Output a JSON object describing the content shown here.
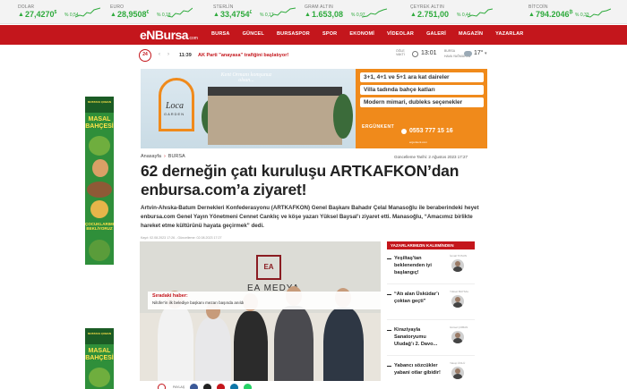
{
  "ticker": [
    {
      "name": "DOLAR",
      "value": "27,4270",
      "sym": "$",
      "pct": "% 0,54"
    },
    {
      "name": "EURO",
      "value": "28,9508",
      "sym": "€",
      "pct": "% 0,18"
    },
    {
      "name": "STERLİN",
      "value": "33,4754",
      "sym": "£",
      "pct": "% 0,17"
    },
    {
      "name": "GRAM ALTIN",
      "value": "1.653,08",
      "sym": "",
      "pct": "% 0,97"
    },
    {
      "name": "ÇEYREK ALTIN",
      "value": "2.751,00",
      "sym": "",
      "pct": "% 0,44"
    },
    {
      "name": "BİTCOİN",
      "value": "794.2046",
      "sym": "₿",
      "pct": "% 0,33"
    }
  ],
  "logo": {
    "en": "eN",
    "bursa": "Bursa",
    "com": ".com"
  },
  "menu": [
    "BURSA",
    "GÜNCEL",
    "BURSASPOR",
    "SPOR",
    "EKONOMİ",
    "VİDEOLAR",
    "GALERİ",
    "MAGAZİN",
    "YAZARLAR"
  ],
  "subbar": {
    "badge": "24",
    "time": "11:39",
    "headline": "AK Parti \"anayasa\" trafiğini başlatıyor!",
    "prayer_label": "ÖĞLE VAKTİ",
    "prayer_time": "13:01",
    "city": "BURSA",
    "weather_label": "HAVA YAĞMURLU",
    "temp": "17°"
  },
  "banner": {
    "kent": "Kent Ormanı komşunuz olsun...",
    "loca": "Loca",
    "garden": "GARDEN",
    "pills": [
      "3+1, 4+1 ve 5+1 ara kat daireler",
      "Villa tadında bahçe katları",
      "Modern mimari, dubleks seçenekler"
    ],
    "brand": "ERGÜNKENT",
    "phone": "0553 777 15 16",
    "email": "ergunkent.com"
  },
  "ad": {
    "title": "MASAL BAHÇESİ",
    "sub": "ÇOCUKLARIMIZ BEKLİYORUZ",
    "brand": "MUSTAFA ÇOBAN"
  },
  "article": {
    "breadcrumb": [
      "Anasayfa",
      "BURSA"
    ],
    "updated": "Güncelleme Tarihi: 2 Ağustos 2023 17:27",
    "title": "62 derneğin çatı kuruluşu ARTKAFKON’dan enbursa.com’a ziyaret!",
    "summary": "Artvin-Ahıska-Batum Dernekleri Konfederasyonu (ARTKAFKON) Genel Başkanı Bahadır Çelal Manasoğlu ile beraberindeki heyet enbursa.com Genel Yayın Yönetmeni Cennet Canklıç ve köşe yazarı Yüksel Baysal’ı ziyaret etti. Manasoğlu, “Amacımız birlikte hareket etme kültürünü hayata geçirmek” dedi.",
    "meta": "Kayıt: 02.08.2023 17:26 - Güncelleme: 02.08.2023 17:27",
    "photo_logo": "EA",
    "photo_text": "EA MEDYA",
    "next_label": "Sıradaki haber:",
    "next_title": "Nilüfer'in ilk belediye başkanı mezarı başında anıldı"
  },
  "share": {
    "count": "PAYLAŞ"
  },
  "sidebar": {
    "header": "YAZARLARIMIZIN KALEMİNDEN",
    "authors": [
      {
        "title": "Yeşiltaş'tan beklenenden iyi başlangıç!",
        "name": "İsmail TOSUN"
      },
      {
        "title": "“Atı alan Üsküdar’ı çoktan geçti”",
        "name": "Yüksel BAYSAL"
      },
      {
        "title": "Kiraziyayla Sanatoryumu Uludağ’ı 2. Davo...",
        "name": "Gürsel ÇOBAN"
      },
      {
        "title": "Yabancı sözcükler yabani otlar gibidir!",
        "name": "Yakup ÜNLÜ"
      }
    ]
  },
  "colors": {
    "brand": "#c4161c",
    "up": "#2eaa3c",
    "banner": "#f08a1b"
  }
}
